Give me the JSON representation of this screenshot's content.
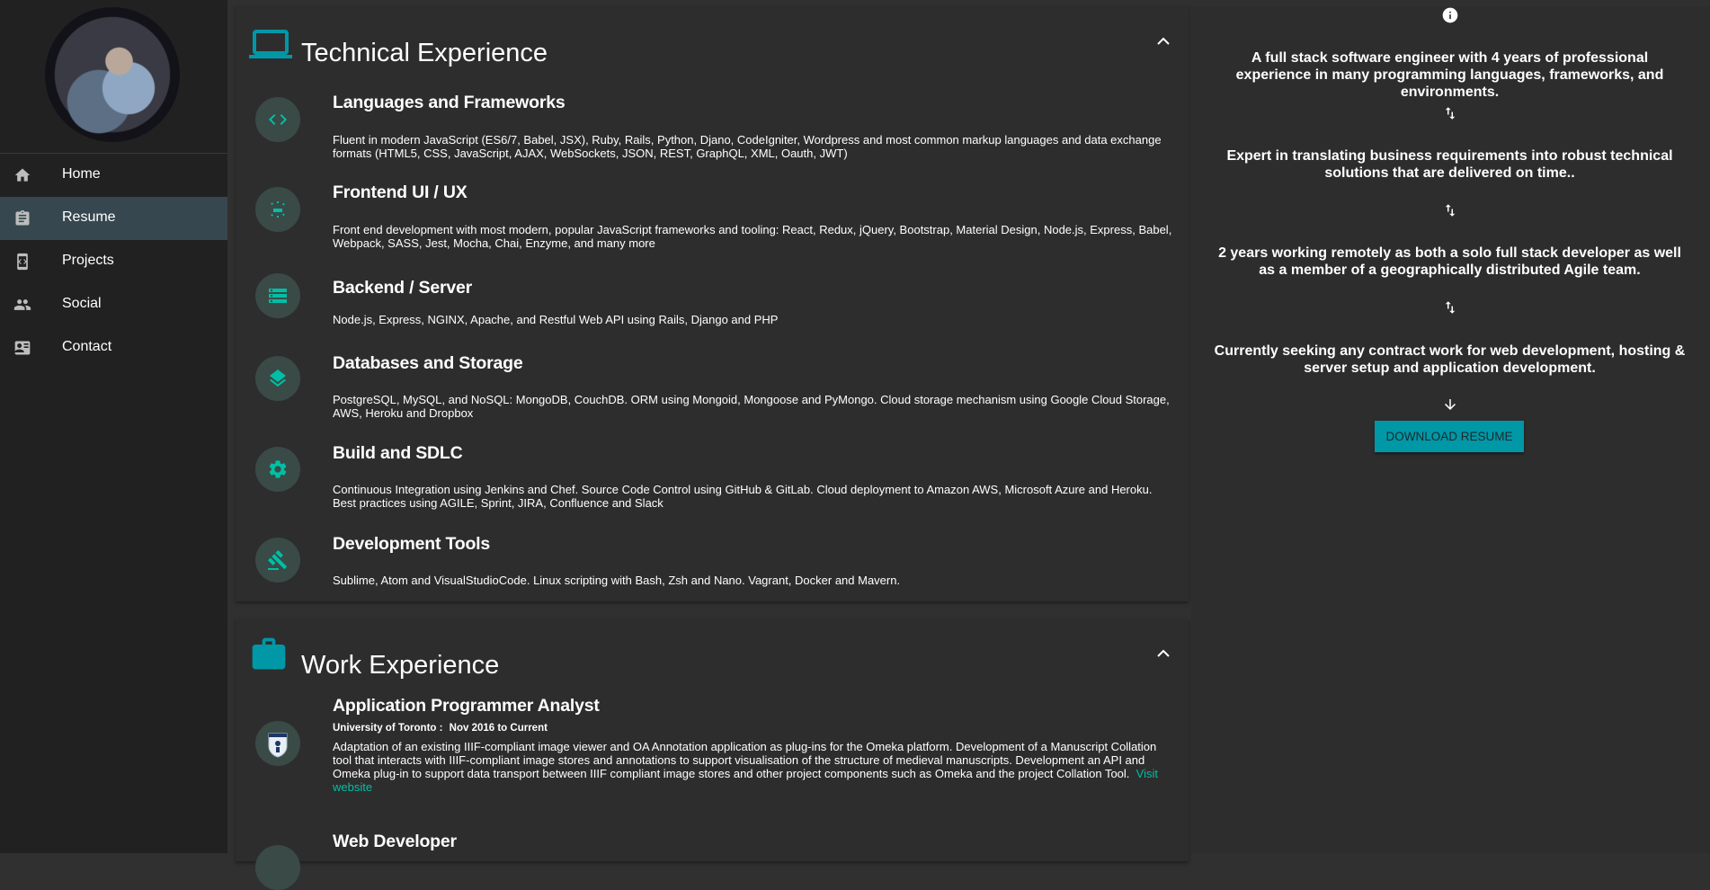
{
  "nav": {
    "items": [
      {
        "label": "Home",
        "icon": "home-icon"
      },
      {
        "label": "Resume",
        "icon": "clipboard-icon"
      },
      {
        "label": "Projects",
        "icon": "phone-code-icon"
      },
      {
        "label": "Social",
        "icon": "people-icon"
      },
      {
        "label": "Contact",
        "icon": "contact-card-icon"
      }
    ],
    "active": "Resume"
  },
  "technical": {
    "title": "Technical Experience",
    "items": [
      {
        "title": "Languages and Frameworks",
        "icon": "code-icon",
        "desc": "Fluent in modern JavaScript (ES6/7, Babel, JSX), Ruby, Rails, Python, Djano, CodeIgniter, Wordpress and most common markup languages and data exchange formats (HTML5, CSS, JavaScript, AJAX, WebSockets, JSON, REST, GraphQL, XML, Oauth, JWT)"
      },
      {
        "title": "Frontend UI / UX",
        "icon": "web-settings-icon",
        "desc": "Front end development with most modern, popular JavaScript frameworks and tooling: React, Redux, jQuery, Bootstrap, Material Design, Node.js, Express, Babel, Webpack, SASS, Jest, Mocha, Chai, Enzyme, and many more"
      },
      {
        "title": "Backend / Server",
        "icon": "server-icon",
        "desc": "Node.js, Express, NGINX, Apache, and Restful Web API using Rails, Django and PHP"
      },
      {
        "title": "Databases and Storage",
        "icon": "layers-icon",
        "desc": "PostgreSQL, MySQL, and NoSQL: MongoDB, CouchDB. ORM using Mongoid, Mongoose and PyMongo. Cloud storage mechanism using Google Cloud Storage, AWS, Heroku and Dropbox"
      },
      {
        "title": "Build and SDLC",
        "icon": "gear-icon",
        "desc": "Continuous Integration using Jenkins and Chef. Source Code Control using GitHub & GitLab. Cloud deployment to Amazon AWS, Microsoft Azure and Heroku. Best practices using AGILE, Sprint, JIRA, Confluence and Slack"
      },
      {
        "title": "Development Tools",
        "icon": "gavel-icon",
        "desc": "Sublime, Atom and VisualStudioCode. Linux scripting with Bash, Zsh and Nano. Vagrant, Docker and Mavern."
      }
    ]
  },
  "work": {
    "title": "Work Experience",
    "items": [
      {
        "title": "Application Programmer Analyst",
        "org": "University of Toronto :",
        "dates": "Nov 2016 to Current",
        "desc": "Adaptation of an existing IIIF-compliant image viewer and OA Annotation application as plug-ins for the Omeka platform. Development of a Manuscript Collation tool that interacts with IIIF-compliant image stores and annotations to support visualisation of the structure of medieval manuscripts. Development an API and Omeka plug-in to support data transport between IIIF compliant image stores and other project components such as Omeka and the project Collation Tool.",
        "link": "Visit website"
      },
      {
        "title": "Web Developer"
      }
    ]
  },
  "summary": {
    "points": [
      "A full stack software engineer with 4 years of professional experience in many programming languages, frameworks, and environments.",
      "Expert in translating business requirements into robust technical solutions that are delivered on time..",
      "2 years working remotely as both a solo full stack developer as well as a member of a geographically distributed Agile team.",
      "Currently seeking any contract work for web development, hosting & server setup and application development."
    ],
    "button": "Download Resume"
  },
  "colors": {
    "accent": "#00bfa5",
    "button": "#0097a7",
    "card_title_icon": "#0097a7"
  }
}
